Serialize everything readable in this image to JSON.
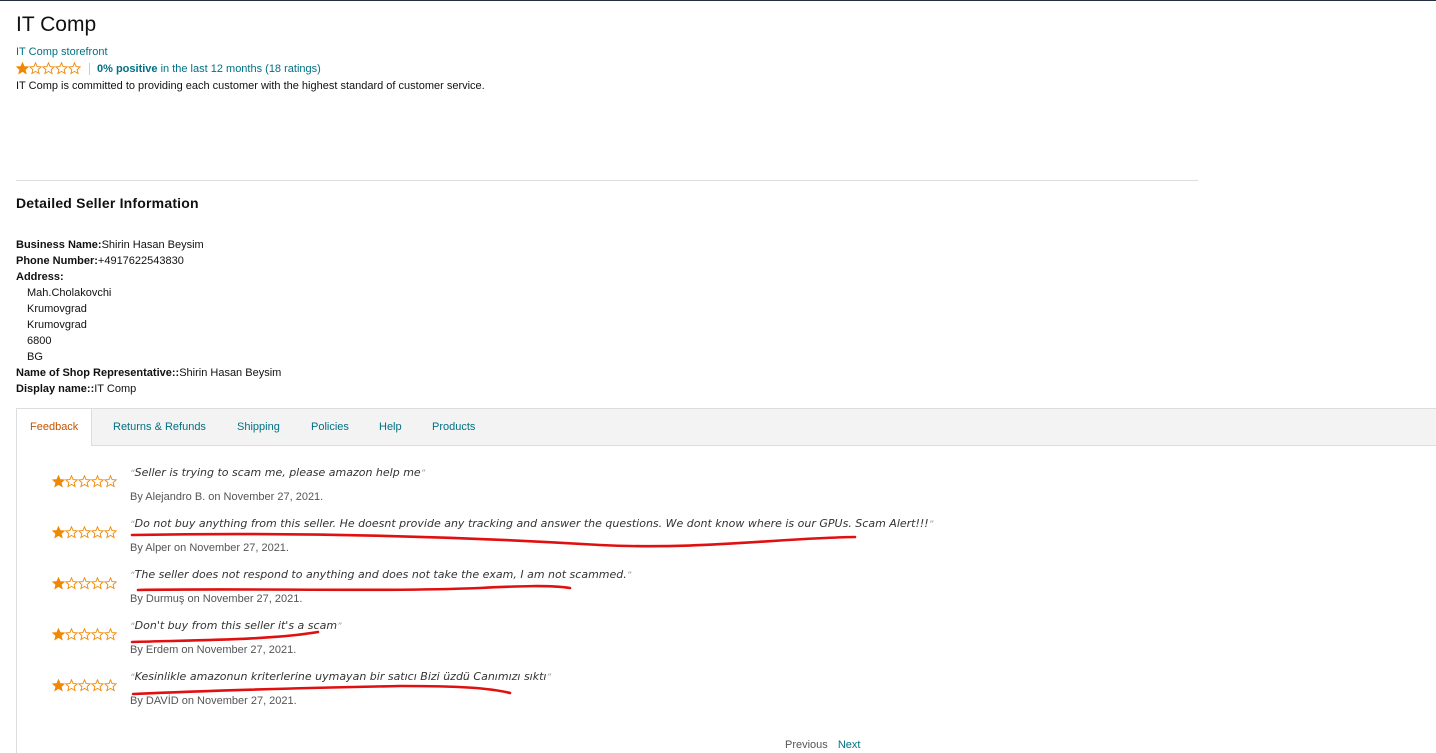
{
  "header": {
    "title": "IT Comp",
    "storefront_link": "IT Comp storefront",
    "rating_stars": 1,
    "rating_max": 5,
    "rating_percent": "0% positive",
    "rating_period": "in the last 12 months (18 ratings)",
    "tagline": "IT Comp is committed to providing each customer with the highest standard of customer service."
  },
  "seller_info": {
    "section_title": "Detailed Seller Information",
    "business_name_label": "Business Name:",
    "business_name": "Shirin Hasan Beysim",
    "phone_label": "Phone Number:",
    "phone": "+4917622543830",
    "address_label": "Address:",
    "address_lines": [
      "Mah.Cholakovchi",
      "Krumovgrad",
      "Krumovgrad",
      "6800",
      "BG"
    ],
    "rep_label": "Name of Shop Representative::",
    "rep_name": "Shirin Hasan Beysim",
    "display_label": "Display name::",
    "display_name": "IT Comp"
  },
  "tabs": [
    {
      "label": "Feedback",
      "active": true
    },
    {
      "label": "Returns & Refunds",
      "active": false
    },
    {
      "label": "Shipping",
      "active": false
    },
    {
      "label": "Policies",
      "active": false
    },
    {
      "label": "Help",
      "active": false
    },
    {
      "label": "Products",
      "active": false
    }
  ],
  "feedback": [
    {
      "stars": 1,
      "text": "Seller is trying to scam me, please amazon help me",
      "by": "By Alejandro B. on November 27, 2021."
    },
    {
      "stars": 1,
      "text": "Do not buy anything from this seller. He doesnt provide any tracking and answer the questions. We dont know where is our GPUs. Scam Alert!!!",
      "by": "By Alper on November 27, 2021."
    },
    {
      "stars": 1,
      "text": "The seller does not respond to anything and does not take the exam, I am not scammed.",
      "by": "By Durmuş on November 27, 2021."
    },
    {
      "stars": 1,
      "text": "Don't buy from this seller it's a scam",
      "by": "By Erdem on November 27, 2021."
    },
    {
      "stars": 1,
      "text": "Kesinlikle amazonun kriterlerine uymayan bir satıcı Bizi üzdü Canımızı sıktı",
      "by": "By DAVİD on November 27, 2021."
    }
  ],
  "pagination": {
    "previous": "Previous",
    "next": "Next"
  },
  "colors": {
    "star": "#f08804",
    "link": "#007185",
    "active_tab": "#c45500",
    "annotation": "#e01010"
  },
  "annotation_marks": "red hand-drawn underlines under feedback 2-5"
}
